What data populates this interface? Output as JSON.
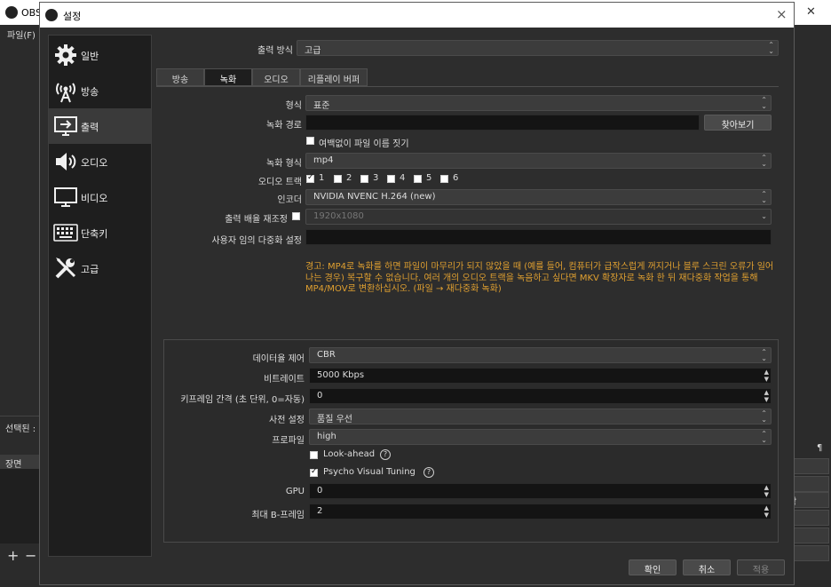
{
  "background_window": {
    "title": "OBS",
    "menu_file": "파일(F)",
    "selected_panel": "선택된 :",
    "scenes_header": "장면",
    "plus": "+",
    "minus": "−",
    "right_label": "작",
    "right_dots": "¶"
  },
  "dialog": {
    "title": "설정",
    "close_icon": "×"
  },
  "sidebar": {
    "items": [
      {
        "label": "일반",
        "icon": "gear-icon"
      },
      {
        "label": "방송",
        "icon": "antenna-icon"
      },
      {
        "label": "출력",
        "icon": "output-monitor-icon",
        "active": true
      },
      {
        "label": "오디오",
        "icon": "speaker-icon"
      },
      {
        "label": "비디오",
        "icon": "monitor-icon"
      },
      {
        "label": "단축키",
        "icon": "keyboard-icon"
      },
      {
        "label": "고급",
        "icon": "tools-icon"
      }
    ]
  },
  "output_mode": {
    "label": "출력 방식",
    "value": "고급"
  },
  "tabs": [
    {
      "label": "방송"
    },
    {
      "label": "녹화",
      "active": true
    },
    {
      "label": "오디오"
    },
    {
      "label": "리플레이 버퍼"
    }
  ],
  "recording": {
    "type_label": "형식",
    "type_value": "표준",
    "path_label": "녹화 경로",
    "path_value": "",
    "browse_button": "찾아보기",
    "no_space_label": "여백없이 파일 이름 짓기",
    "format_label": "녹화 형식",
    "format_value": "mp4",
    "audio_track_label": "오디오 트랙",
    "tracks": [
      "1",
      "2",
      "3",
      "4",
      "5",
      "6"
    ],
    "encoder_label": "인코더",
    "encoder_value": "NVIDIA NVENC H.264 (new)",
    "rescale_label": "출력 배율 재조정",
    "rescale_value": "1920x1080",
    "muxer_label": "사용자 임의 다중화 설정",
    "muxer_value": "",
    "warning": "경고: MP4로 녹화를 하면 파일이 마무리가 되지 않았을 때 (예를 들어, 컴퓨터가 급작스럽게 꺼지거나 블루 스크린 오류가 일어나는 경우) 복구할 수 없습니다. 여러 개의 오디오 트랙을 녹음하고 싶다면 MKV 확장자로 녹화 한 뒤 재다중화 작업을 통해 MP4/MOV로 변환하십시오. (파일 → 재다중화 녹화)"
  },
  "encoder": {
    "rate_control_label": "데이터율 제어",
    "rate_control_value": "CBR",
    "bitrate_label": "비트레이트",
    "bitrate_value": "5000 Kbps",
    "keyframe_label": "키프레임 간격 (초 단위, 0=자동)",
    "keyframe_value": "0",
    "preset_label": "사전 설정",
    "preset_value": "품질 우선",
    "profile_label": "프로파일",
    "profile_value": "high",
    "lookahead_label": "Look-ahead",
    "psycho_label": "Psycho Visual Tuning",
    "gpu_label": "GPU",
    "gpu_value": "0",
    "bframes_label": "최대 B-프레임",
    "bframes_value": "2"
  },
  "footer": {
    "ok": "확인",
    "cancel": "취소",
    "apply": "적용"
  }
}
